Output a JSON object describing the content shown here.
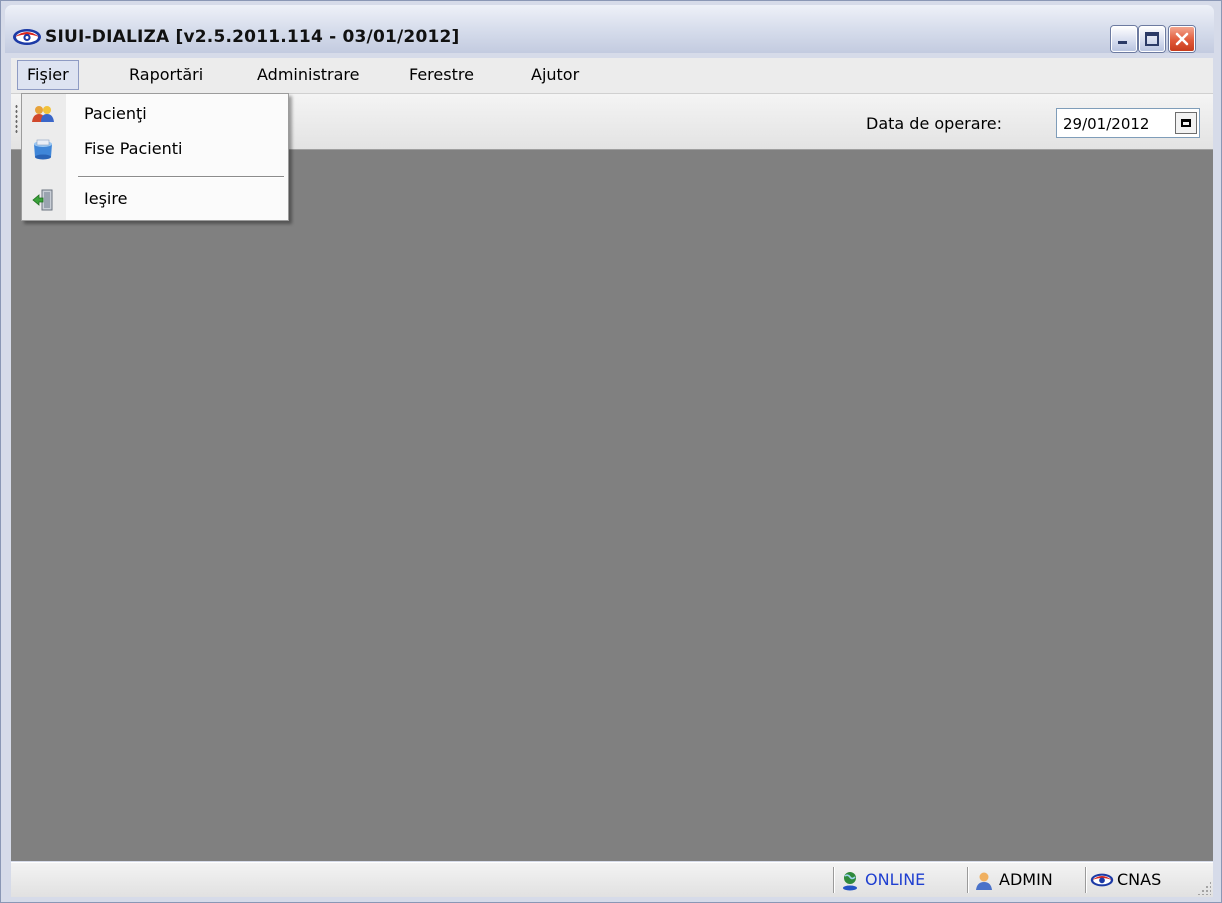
{
  "window": {
    "title": "SIUI-DIALIZA [v2.5.2011.114 - 03/01/2012]",
    "app_icon": "cnas-eye-logo-icon"
  },
  "menubar": {
    "items": [
      {
        "label": "Fişier",
        "active": true
      },
      {
        "label": "Raportări"
      },
      {
        "label": "Administrare"
      },
      {
        "label": "Ferestre"
      },
      {
        "label": "Ajutor"
      }
    ]
  },
  "dropdown": {
    "items": [
      {
        "label": "Pacienţi",
        "icon": "patients-icon"
      },
      {
        "label": "Fise Pacienti",
        "icon": "patient-records-icon"
      },
      {
        "label": "Ieşire",
        "icon": "exit-icon"
      }
    ]
  },
  "toolbar": {
    "date_label": "Data de operare:",
    "date_value": "29/01/2012"
  },
  "statusbar": {
    "online": "ONLINE",
    "user": "ADMIN",
    "org": "CNAS"
  },
  "colors": {
    "workspace": "#808080",
    "online_text": "#1f3fd0",
    "close_button": "#e15a3a"
  }
}
